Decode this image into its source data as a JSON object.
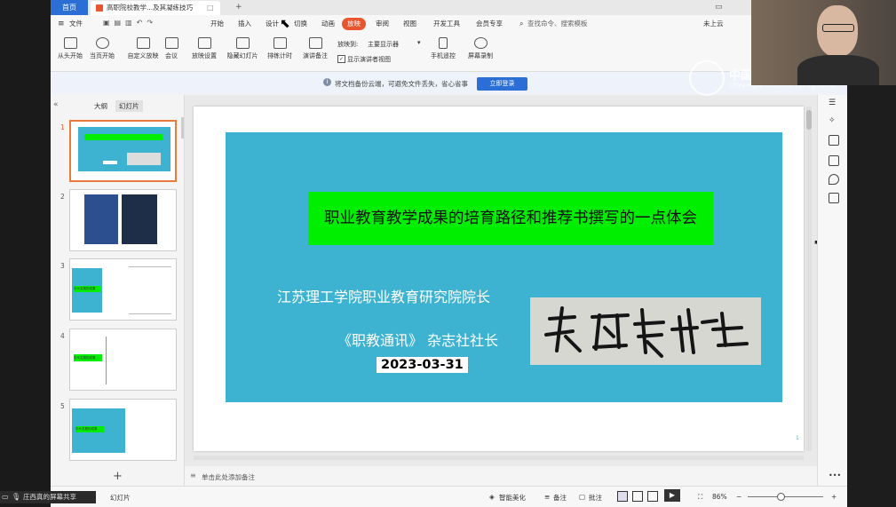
{
  "tabs": {
    "home": "首页",
    "doc": "高职院校教学...及其凝练技巧"
  },
  "menu": {
    "file": "文件",
    "items": [
      "开始",
      "插入",
      "设计",
      "切换",
      "动画",
      "放映",
      "审阅",
      "视图",
      "开发工具",
      "会员专享"
    ],
    "active_index": 5,
    "search": "查找命令、搜索模板",
    "cloud": "未上云"
  },
  "ribbon": {
    "buttons": [
      "从头开始",
      "当页开始",
      "自定义放映",
      "会议",
      "放映设置",
      "隐藏幻灯片",
      "排练计时",
      "演讲备注"
    ],
    "monitor_label": "放映到:",
    "monitor_value": "主要显示器",
    "presenter_view": "显示演讲者视图",
    "phone": "手机遥控",
    "record": "屏幕录制"
  },
  "notice": {
    "text": "将文档备份云端，可避免文件丢失，省心省事",
    "button": "立即登录"
  },
  "panel": {
    "outline": "大纲",
    "slides": "幻灯片"
  },
  "thumbs": [
    {
      "num": "1"
    },
    {
      "num": "2"
    },
    {
      "num": "3",
      "box_text": "中头发展的成果"
    },
    {
      "num": "4",
      "box_text": "中头发展的成果"
    },
    {
      "num": "5",
      "box_text": "中头发展的成果"
    }
  ],
  "slide": {
    "title": "职业教育教学成果的培育路径和推荐书撰写的一点体会",
    "line1": "江苏理工学院职业教育研究院院长",
    "line2": "《职教通讯》 杂志社社长",
    "date": "2023-03-31",
    "slide_no": "1"
  },
  "notes": "单击此处添加备注",
  "status": {
    "slide_label": "幻灯片",
    "beautify": "智能美化",
    "notes": "备注",
    "comments": "批注",
    "zoom": "86%"
  },
  "watermark": {
    "cn": "中国高等教育培训中心",
    "en": "China Higher Education Training Center"
  },
  "share": "庄西真的屏幕共享",
  "colors": {
    "accent": "#2b6fd6",
    "active_tab": "#e8552f",
    "slide_bg": "#3db3d1",
    "title_bg": "#00ee00"
  }
}
